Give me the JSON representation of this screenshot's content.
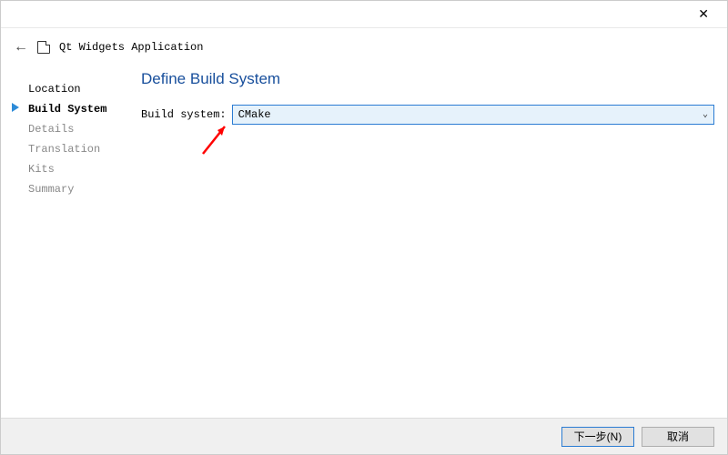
{
  "window": {
    "title": "Qt Widgets Application"
  },
  "sidebar": {
    "items": [
      {
        "label": "Location",
        "state": "done"
      },
      {
        "label": "Build System",
        "state": "current"
      },
      {
        "label": "Details",
        "state": "pending"
      },
      {
        "label": "Translation",
        "state": "pending"
      },
      {
        "label": "Kits",
        "state": "pending"
      },
      {
        "label": "Summary",
        "state": "pending"
      }
    ]
  },
  "main": {
    "title": "Define Build System",
    "field_label": "Build system:",
    "selected_value": "CMake"
  },
  "footer": {
    "next_label": "下一步(N)",
    "cancel_label": "取消"
  }
}
